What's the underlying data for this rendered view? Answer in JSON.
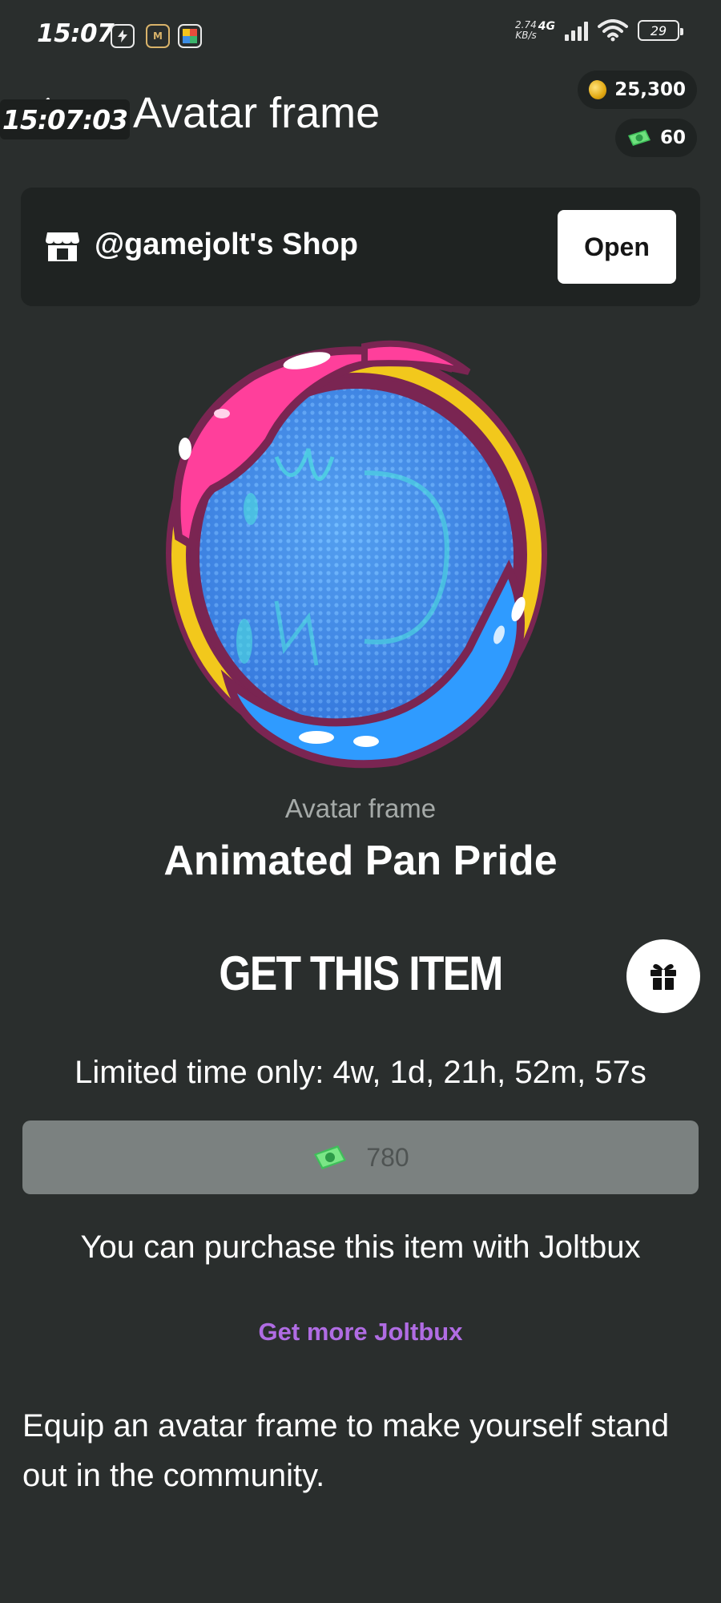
{
  "status_bar": {
    "time": "15:07",
    "net_speed_value": "2.74",
    "net_speed_unit": "KB/s",
    "network_gen": "4G",
    "battery": "29"
  },
  "header": {
    "timer": "15:07:03",
    "title": "Avatar frame",
    "coins": "25,300",
    "joltbux": "60"
  },
  "shop": {
    "name": "@gamejolt's Shop",
    "open_label": "Open"
  },
  "item": {
    "type": "Avatar frame",
    "name": "Animated Pan Pride"
  },
  "purchase": {
    "heading": "GET THIS ITEM",
    "limited": "Limited time only: 4w, 1d, 21h, 52m, 57s",
    "price": "780",
    "note": "You can purchase this item with Joltbux",
    "more_link": "Get more Joltbux"
  },
  "description": "Equip an avatar frame to make yourself stand out in the community.",
  "colors": {
    "background": "#2a2e2d",
    "card": "#1f2322",
    "link": "#b06ce3",
    "price_button": "#7b8180",
    "frame_pink": "#ff3f9b",
    "frame_yellow": "#f2c81c",
    "frame_blue": "#2f9bff"
  }
}
